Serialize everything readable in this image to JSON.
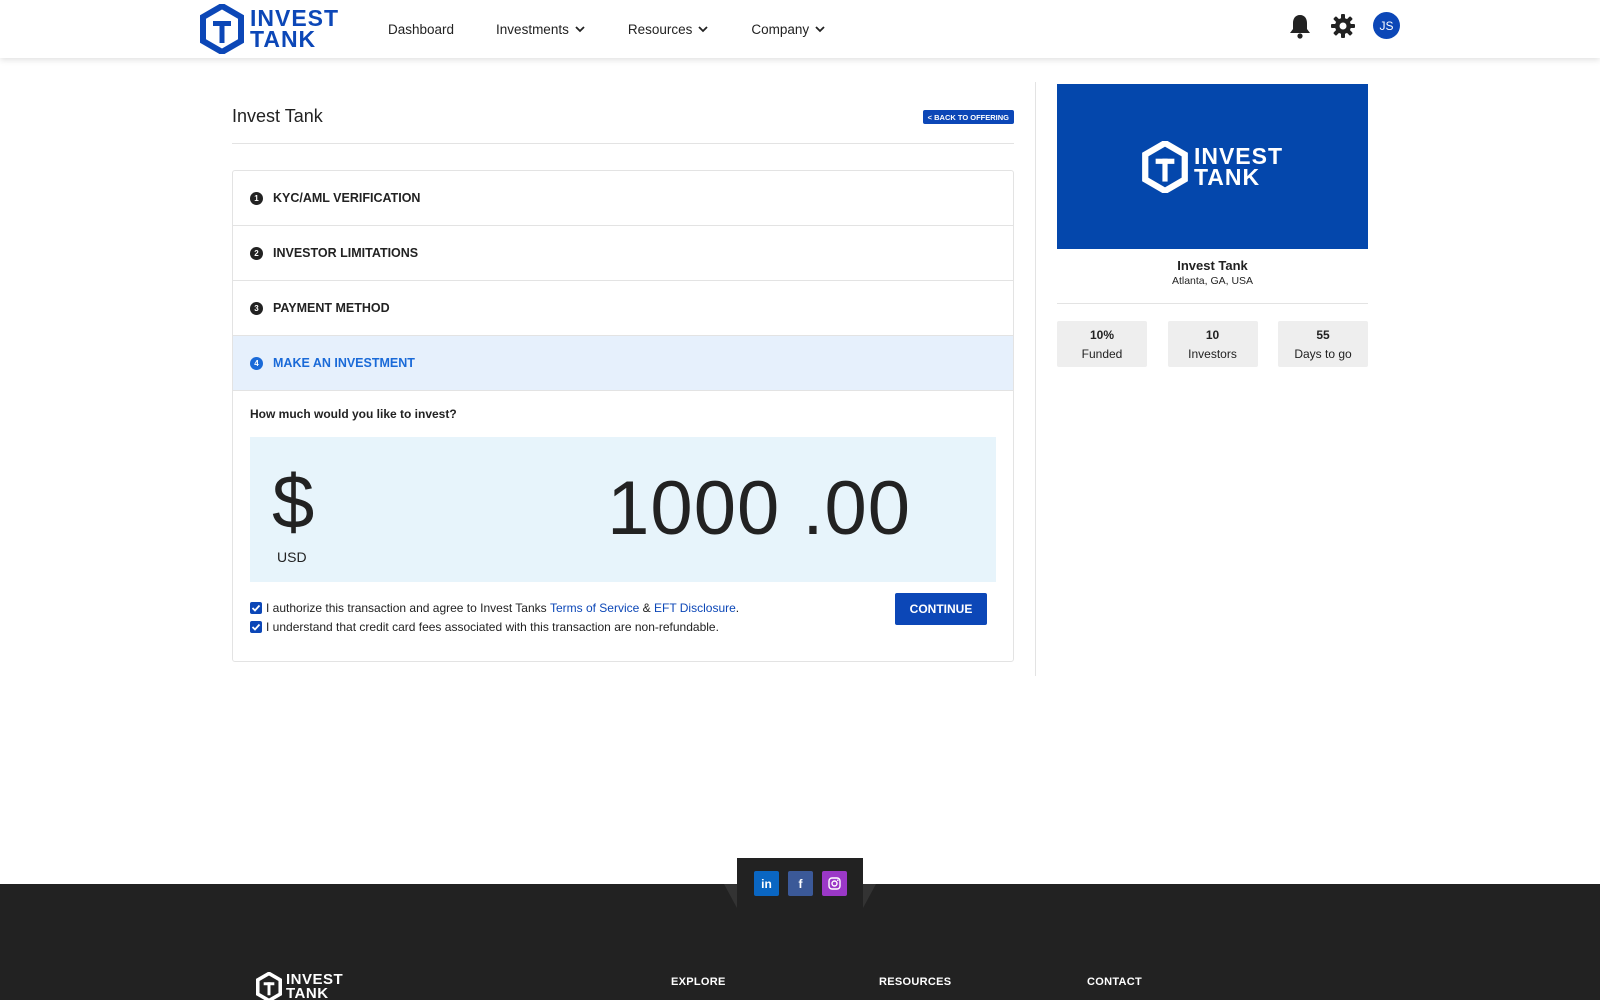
{
  "brand": {
    "name_line1": "INVEST",
    "name_line2": "TANK",
    "color": "#0c47b7"
  },
  "header": {
    "nav": [
      {
        "label": "Dashboard",
        "has_dropdown": false
      },
      {
        "label": "Investments",
        "has_dropdown": true
      },
      {
        "label": "Resources",
        "has_dropdown": true
      },
      {
        "label": "Company",
        "has_dropdown": true
      }
    ],
    "icons": [
      "bell-icon",
      "gear-icon"
    ],
    "avatar_initials": "JS"
  },
  "page": {
    "title": "Invest Tank",
    "back_label": "< BACK TO OFFERING"
  },
  "steps": [
    {
      "num": "1",
      "label": "KYC/AML VERIFICATION",
      "active": false
    },
    {
      "num": "2",
      "label": "INVESTOR LIMITATIONS",
      "active": false
    },
    {
      "num": "3",
      "label": "PAYMENT METHOD",
      "active": false
    },
    {
      "num": "4",
      "label": "MAKE AN INVESTMENT",
      "active": true
    }
  ],
  "investment": {
    "question": "How much would you like to invest?",
    "currency_symbol": "$",
    "currency_code": "USD",
    "amount": "1000 .00",
    "authorize_text_pre": "I authorize this transaction and agree to Invest Tanks ",
    "terms_link": "Terms of Service",
    "amp": " & ",
    "eft_link": "EFT Disclosure",
    "authorize_text_post": ".",
    "fees_text": "I understand that credit card fees associated with this transaction are non-refundable.",
    "authorize_checked": true,
    "fees_checked": true,
    "continue_label": "CONTINUE"
  },
  "offering": {
    "banner_line1": "INVEST",
    "banner_line2": "TANK",
    "banner_color": "#0447ac",
    "name": "Invest Tank",
    "location": "Atlanta, GA, USA",
    "stats": [
      {
        "value": "10%",
        "label": "Funded"
      },
      {
        "value": "10",
        "label": "Investors"
      },
      {
        "value": "55",
        "label": "Days to go"
      }
    ]
  },
  "footer": {
    "social": [
      {
        "icon": "linkedin-icon",
        "glyph": "in"
      },
      {
        "icon": "facebook-icon",
        "glyph": "f"
      },
      {
        "icon": "instagram-icon",
        "glyph": ""
      }
    ],
    "logo_line1": "INVEST",
    "logo_line2": "TANK",
    "columns": [
      "EXPLORE",
      "RESOURCES",
      "CONTACT"
    ]
  }
}
